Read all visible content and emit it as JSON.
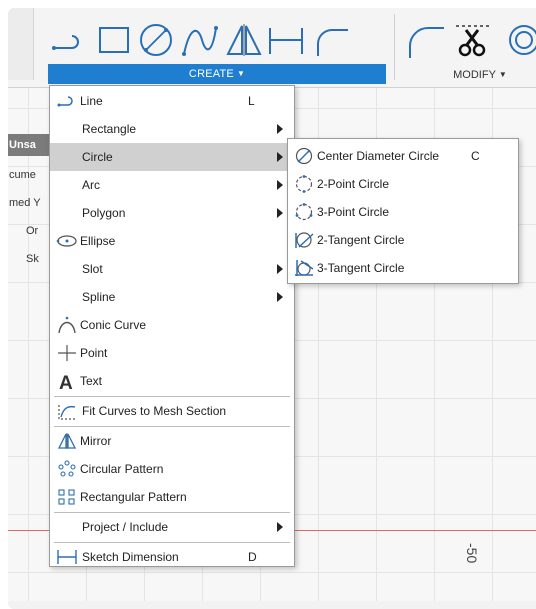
{
  "browser_panel": {
    "rows": [
      "Unsa",
      "cume",
      "med Y",
      "Or",
      "Sk"
    ]
  },
  "toolbar": {
    "create_label": "CREATE",
    "modify_label": "MODIFY",
    "tools": [
      "line-tool-icon",
      "rectangle-tool-icon",
      "circle-tool-icon",
      "spline-tool-icon",
      "mirror-tool-icon",
      "dimension-tool-icon",
      "fillet-tool-icon",
      "trim-tool-icon"
    ]
  },
  "create_menu": {
    "items": [
      {
        "label": "Line",
        "shortcut": "L",
        "submenu": false,
        "icon": "line-icon"
      },
      {
        "label": "Rectangle",
        "submenu": true
      },
      {
        "label": "Circle",
        "submenu": true,
        "highlighted": true
      },
      {
        "label": "Arc",
        "submenu": true
      },
      {
        "label": "Polygon",
        "submenu": true
      },
      {
        "label": "Ellipse",
        "submenu": false,
        "icon": "ellipse-icon"
      },
      {
        "label": "Slot",
        "submenu": true
      },
      {
        "label": "Spline",
        "submenu": true
      },
      {
        "label": "Conic Curve",
        "submenu": false,
        "icon": "conic-curve-icon"
      },
      {
        "label": "Point",
        "submenu": false,
        "icon": "point-icon"
      },
      {
        "label": "Text",
        "submenu": false,
        "icon": "text-icon"
      },
      {
        "label": "Fit Curves to Mesh Section",
        "submenu": false,
        "icon": "fit-curves-icon"
      },
      {
        "label": "Mirror",
        "submenu": false,
        "icon": "mirror-icon"
      },
      {
        "label": "Circular Pattern",
        "submenu": false,
        "icon": "circular-pattern-icon"
      },
      {
        "label": "Rectangular Pattern",
        "submenu": false,
        "icon": "rectangular-pattern-icon"
      },
      {
        "label": "Project / Include",
        "submenu": true
      },
      {
        "label": "Sketch Dimension",
        "shortcut": "D",
        "submenu": false,
        "icon": "sketch-dimension-icon"
      }
    ]
  },
  "circle_submenu": {
    "items": [
      {
        "label": "Center Diameter Circle",
        "shortcut": "C",
        "icon": "center-diameter-circle-icon"
      },
      {
        "label": "2-Point Circle",
        "icon": "two-point-circle-icon"
      },
      {
        "label": "3-Point Circle",
        "icon": "three-point-circle-icon"
      },
      {
        "label": "2-Tangent Circle",
        "icon": "two-tangent-circle-icon"
      },
      {
        "label": "3-Tangent Circle",
        "icon": "three-tangent-circle-icon"
      }
    ]
  },
  "canvas": {
    "axis_value": "-50"
  },
  "colors": {
    "accent": "#1f7ecf",
    "menu_highlight": "#d0d0d0",
    "icon_blue": "#2a6fb5",
    "axis_red": "#e06a6a"
  }
}
